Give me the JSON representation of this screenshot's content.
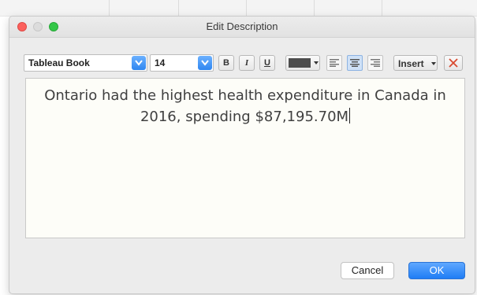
{
  "window": {
    "title": "Edit Description"
  },
  "toolbar": {
    "font_family": "Tableau Book",
    "font_size": "14",
    "bold_label": "B",
    "italic_label": "I",
    "underline_label": "U",
    "text_color": "#4d4d4d",
    "alignment": "center",
    "insert_label": "Insert",
    "insert_caret": "▾"
  },
  "editor": {
    "line1": "Ontario had the highest health expenditure in Canada in",
    "line2": "2016, spending $87,195.70M"
  },
  "footer": {
    "cancel_label": "Cancel",
    "ok_label": "OK"
  },
  "colors": {
    "accent": "#2f86f0",
    "close": "#fc605c",
    "maximize": "#34c748",
    "editor_bg": "#fdfdf8"
  }
}
